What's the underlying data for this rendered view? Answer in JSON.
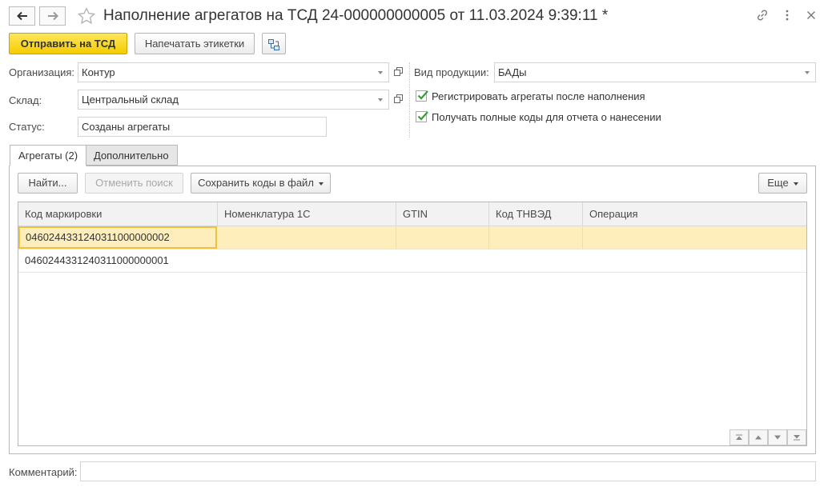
{
  "window": {
    "title": "Наполнение агрегатов на ТСД 24-000000000005 от 11.03.2024 9:39:11 *"
  },
  "icons": {
    "back": "arrow-left-icon",
    "forward": "arrow-right-icon",
    "favorite": "star-icon",
    "link": "link-icon",
    "more": "more-vertical-icon",
    "close": "close-icon"
  },
  "toolbar": {
    "send_label": "Отправить на ТСД",
    "print_label": "Напечатать этикетки"
  },
  "form": {
    "org_label": "Организация:",
    "org_value": "Контур",
    "warehouse_label": "Склад:",
    "warehouse_value": "Центральный склад",
    "status_label": "Статус:",
    "status_value": "Созданы агрегаты",
    "product_type_label": "Вид продукции:",
    "product_type_value": "БАДы",
    "register_label": "Регистрировать агрегаты после наполнения",
    "register_checked": true,
    "fullcodes_label": "Получать полные коды для отчета о нанесении",
    "fullcodes_checked": true
  },
  "tabs": [
    {
      "label": "Агрегаты (2)",
      "active": true
    },
    {
      "label": "Дополнительно",
      "active": false
    }
  ],
  "table_toolbar": {
    "find_label": "Найти...",
    "cancel_search_label": "Отменить поиск",
    "save_codes_label": "Сохранить коды в файл",
    "more_label": "Еще"
  },
  "table": {
    "columns": [
      "Код маркировки",
      "Номенклатура 1С",
      "GTIN",
      "Код ТНВЭД",
      "Операция"
    ],
    "rows": [
      [
        "0460244331240311000000002",
        "",
        "",
        "",
        ""
      ],
      [
        "0460244331240311000000001",
        "",
        "",
        "",
        ""
      ]
    ]
  },
  "comment": {
    "label": "Комментарий:",
    "value": ""
  },
  "colors": {
    "primary_button": "#f4cc00",
    "selected_row": "#fdeebc",
    "checkbox_check": "#3a9a3a"
  }
}
